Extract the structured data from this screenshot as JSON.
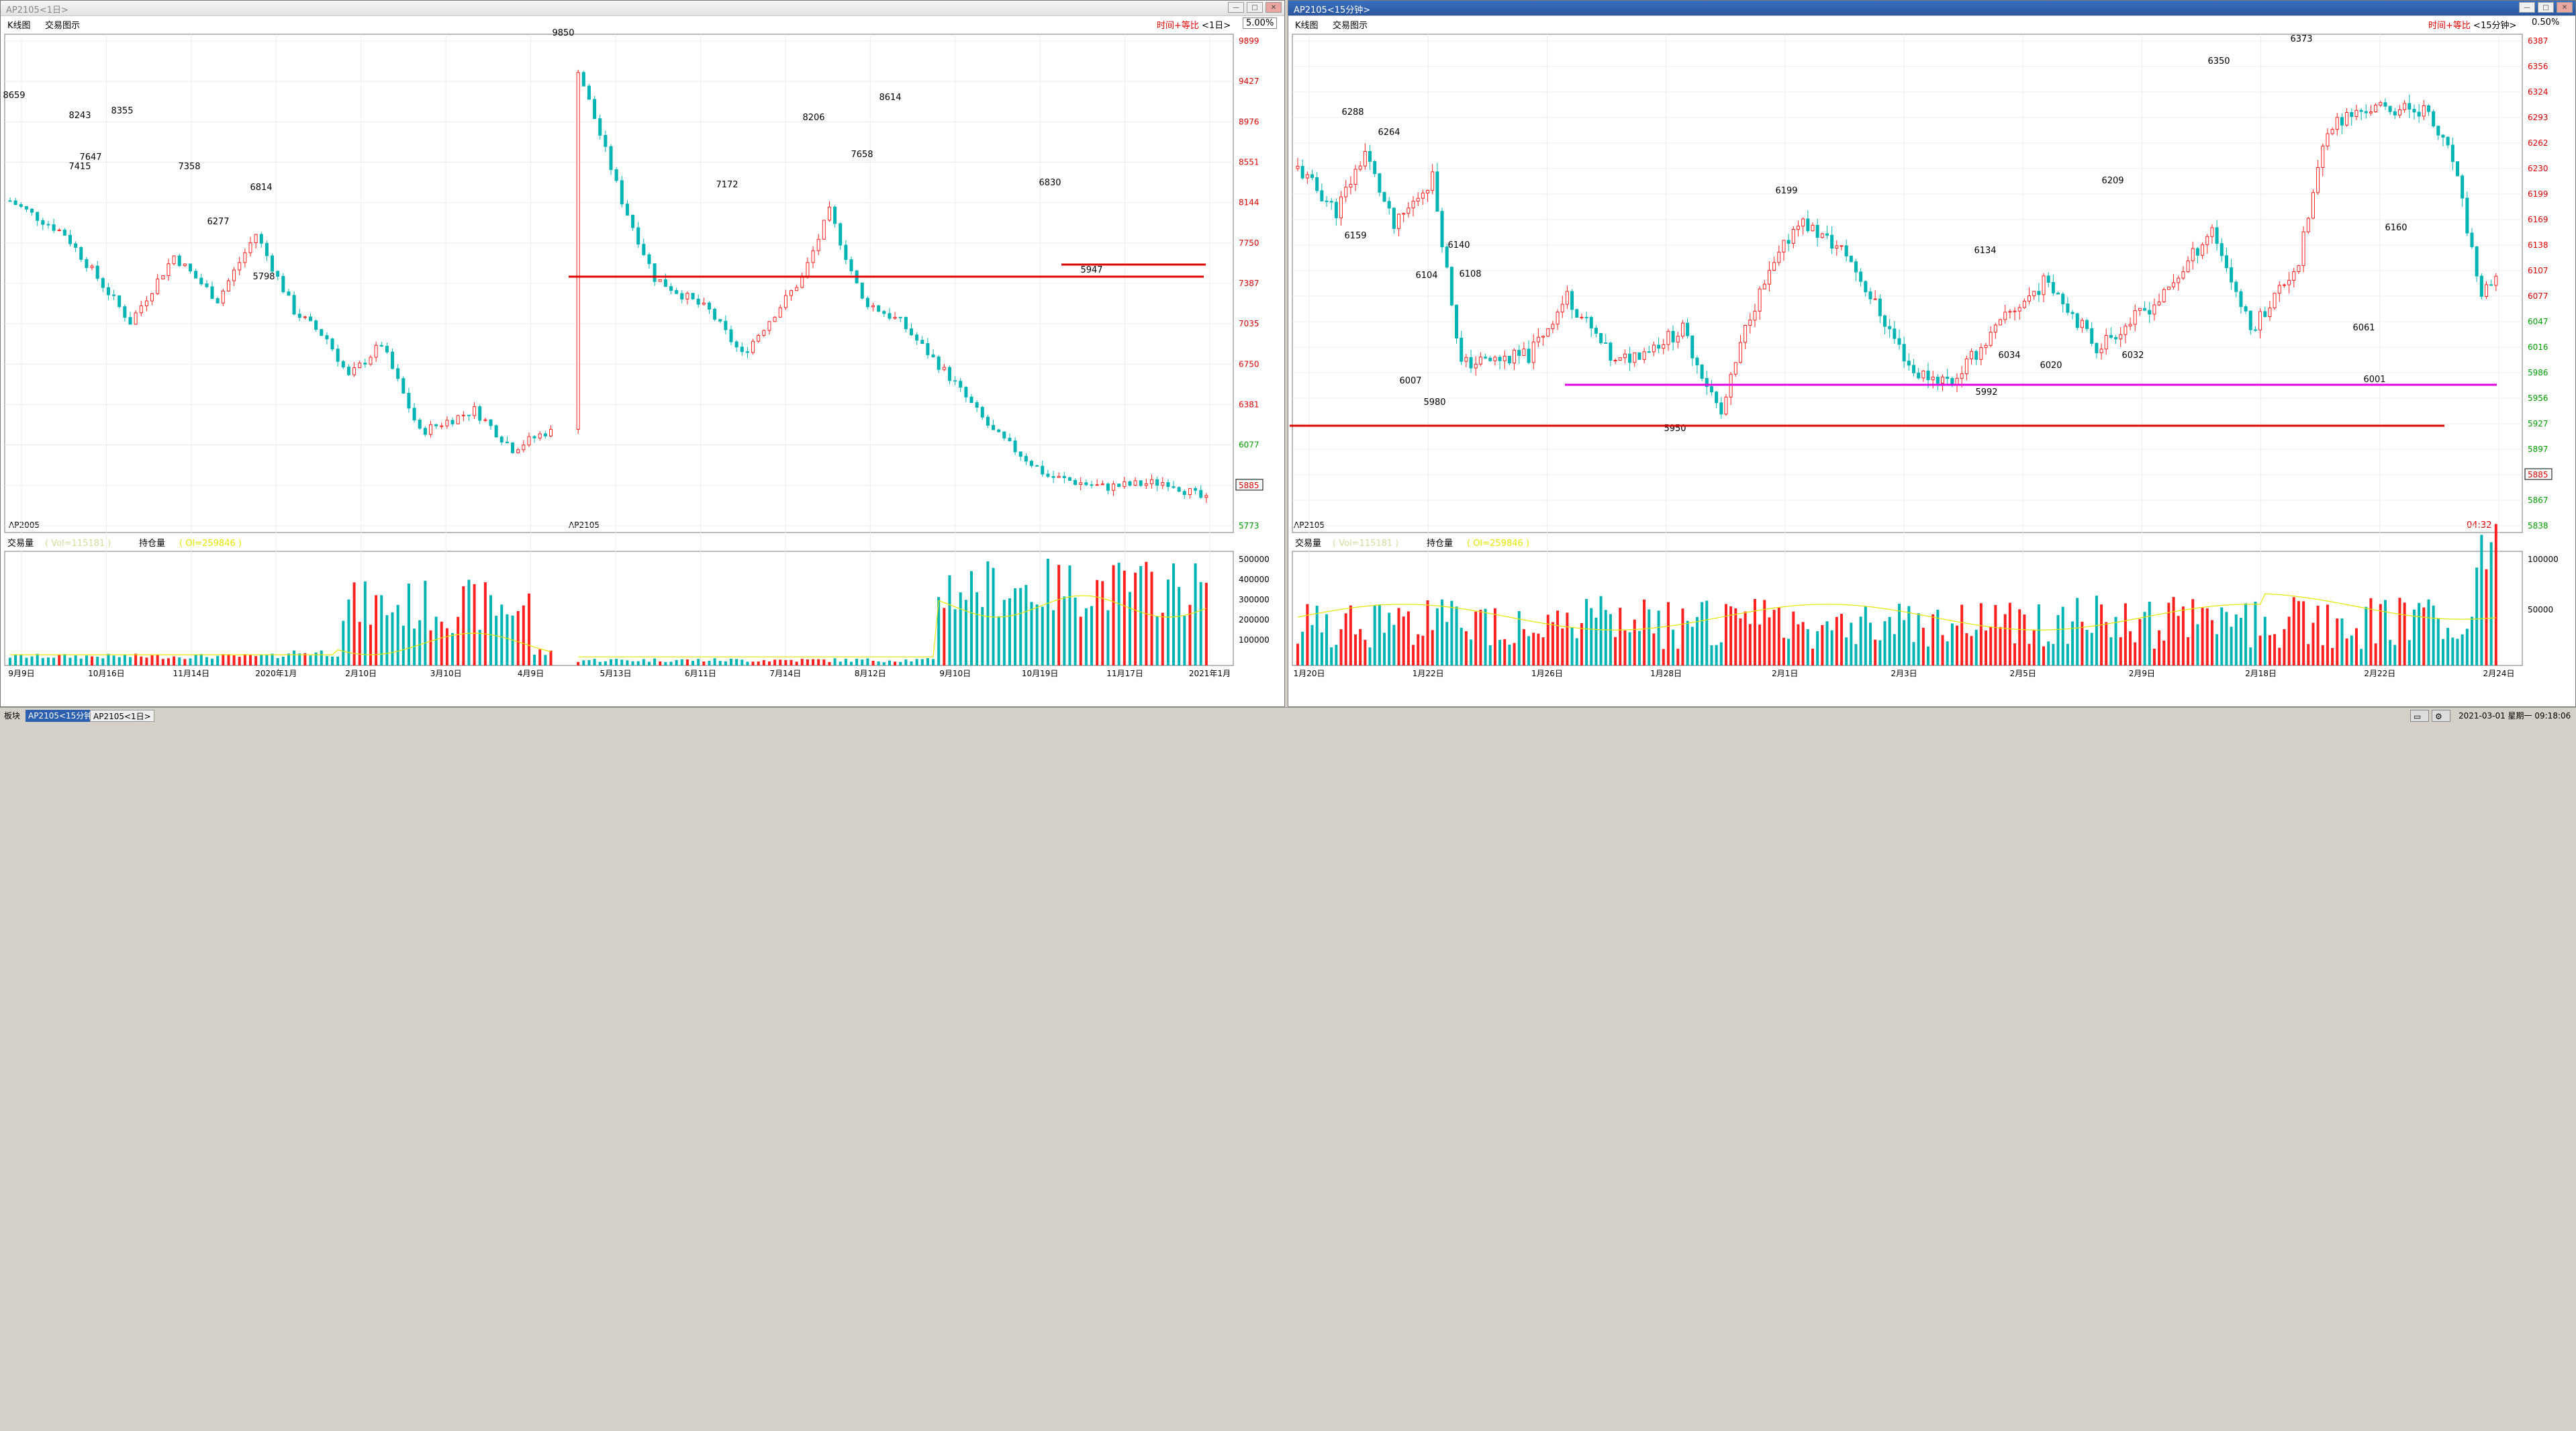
{
  "left": {
    "title": "AP2105<1日>",
    "menu": [
      "K线图",
      "交易图示"
    ],
    "right_label": "时间+等比",
    "period": "<1日>",
    "pct": "5.00%",
    "symbol_left": "AP2005",
    "symbol_mid": "AP2105",
    "price_axis": [
      "9899",
      "9427",
      "8976",
      "8551",
      "8144",
      "7750",
      "7387",
      "7035",
      "6750",
      "6381",
      "6077",
      "5885",
      "5773"
    ],
    "current_price": "5885",
    "volume_header": {
      "label": "交易量",
      "field": "Vol=115181",
      "oi_label": "持仓量",
      "oi_field": "OI=259846"
    },
    "volume_axis": [
      "500000",
      "400000",
      "300000",
      "200000",
      "100000"
    ],
    "date_axis": [
      "9月9日",
      "10月16日",
      "11月14日",
      "2020年1月",
      "2月10日",
      "3月10日",
      "4月9日",
      "5月13日",
      "6月11日",
      "7月14日",
      "8月12日",
      "9月10日",
      "10月19日",
      "11月17日",
      "2021年1月"
    ],
    "annotations": [
      "8659",
      "7415",
      "8243",
      "7647",
      "8355",
      "7358",
      "6277",
      "6814",
      "5798",
      "9850",
      "7172",
      "8206",
      "7658",
      "8614",
      "6830",
      "5947"
    ]
  },
  "right": {
    "title": "AP2105<15分钟>",
    "menu": [
      "K线图",
      "交易图示"
    ],
    "right_label": "时间+等比",
    "period": "<15分钟>",
    "pct": "0.50%",
    "symbol_left": "AP2105",
    "countdown": "04:32",
    "price_axis": [
      "6387",
      "6356",
      "6324",
      "6293",
      "6262",
      "6230",
      "6199",
      "6169",
      "6138",
      "6107",
      "6077",
      "6047",
      "6016",
      "5986",
      "5956",
      "5927",
      "5897",
      "5885",
      "5867",
      "5838"
    ],
    "current_price": "5885",
    "volume_header": {
      "label": "交易量",
      "field": "Vol=115181",
      "oi_label": "持仓量",
      "oi_field": "OI=259846"
    },
    "volume_axis": [
      "100000",
      "50000"
    ],
    "date_axis": [
      "1月20日",
      "1月22日",
      "1月26日",
      "1月28日",
      "2月1日",
      "2月3日",
      "2月5日",
      "2月9日",
      "2月18日",
      "2月22日",
      "2月24日"
    ],
    "annotations": [
      "6288",
      "6159",
      "6264",
      "6104",
      "6007",
      "5980",
      "6140",
      "6108",
      "5950",
      "6199",
      "6134",
      "5992",
      "6034",
      "6020",
      "6209",
      "6032",
      "6350",
      "6373",
      "6061",
      "6001",
      "6160"
    ]
  },
  "statusbar": {
    "left_label": "板块",
    "tabs": [
      "AP2105<15分钟>",
      "AP2105<1日>"
    ],
    "datetime": "2021-03-01 星期一 09:18:06"
  }
}
